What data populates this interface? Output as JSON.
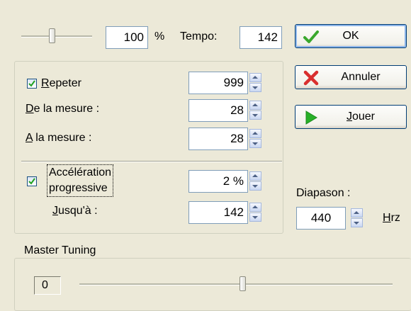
{
  "top": {
    "speed_value": "100",
    "percent_label": "%",
    "tempo_label": "Tempo:",
    "tempo_value": "142",
    "speed_slider_level": 0.5
  },
  "buttons": {
    "ok_label": "OK",
    "cancel_label": "Annuler",
    "play_label": "Jouer"
  },
  "repeat": {
    "repeat_label": "Repeter",
    "repeat_accel": "e",
    "repeat_value": "999",
    "from_label": "De la mesure :",
    "from_value": "28",
    "to_label": "A la mesure :",
    "to_value": "28"
  },
  "acceleration": {
    "label_line1": "Accélération",
    "label_line2": "progressive",
    "value": "2 %",
    "until_label": "Jusqu'à :",
    "until_value": "142"
  },
  "diapason": {
    "label": "Diapason :",
    "value": "440",
    "unit": "Hrz"
  },
  "master_tuning": {
    "title": "Master Tuning",
    "value": "0",
    "slider_level": 0.5
  },
  "colors": {
    "background": "#ece9d8",
    "ok_check": "#3aa82d",
    "cancel_x": "#d92f2f",
    "play_triangle": "#28b028"
  }
}
